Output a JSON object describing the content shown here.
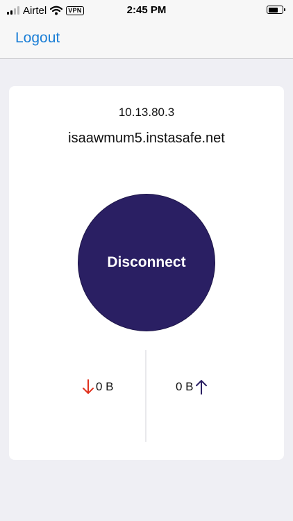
{
  "status_bar": {
    "carrier": "Airtel",
    "vpn_badge": "VPN",
    "time": "2:45 PM",
    "signal_bars": 4,
    "signal_bars_active": 2,
    "battery_level": 0.75
  },
  "nav": {
    "logout_label": "Logout"
  },
  "connection": {
    "ip": "10.13.80.3",
    "host": "isaawmum5.instasafe.net",
    "button_label": "Disconnect"
  },
  "stats": {
    "download": {
      "value": "0 B",
      "icon": "arrow-down-icon",
      "color": "#e0321e"
    },
    "upload": {
      "value": "0 B",
      "icon": "arrow-up-icon",
      "color": "#2a1f63"
    }
  },
  "colors": {
    "accent": "#1a7ed6",
    "button": "#2a1f63",
    "background": "#efeff4",
    "card": "#ffffff"
  }
}
